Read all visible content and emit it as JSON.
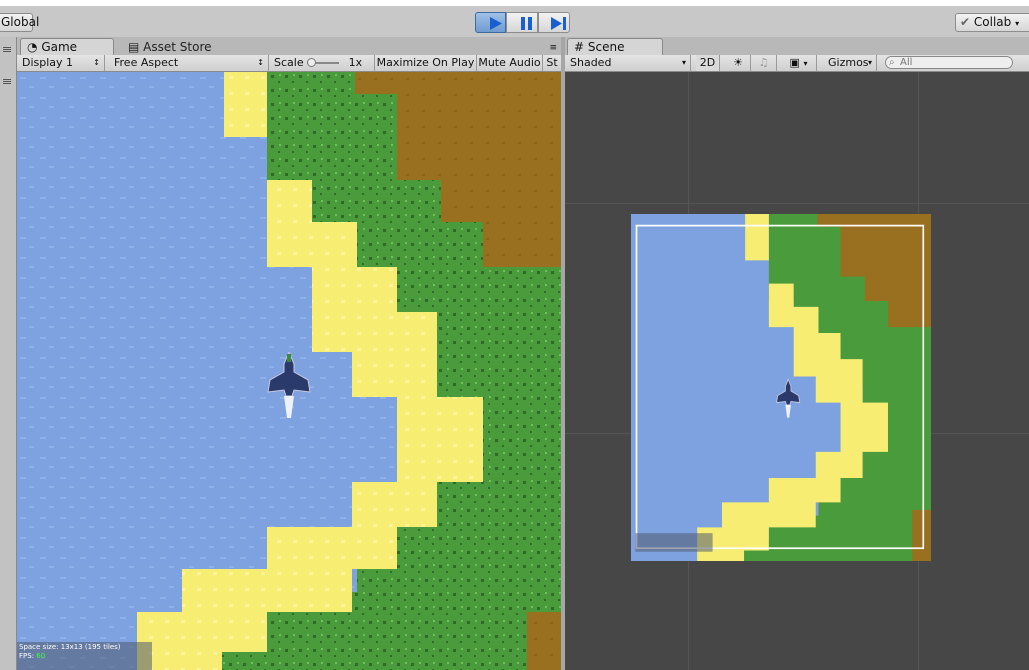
{
  "toolbar": {
    "global_label": "Global",
    "collab_label": "Collab",
    "play_icon": "play-icon",
    "pause_icon": "pause-icon",
    "step_icon": "step-icon",
    "accent": "#3f6aa0"
  },
  "game_panel": {
    "tab_game": "Game",
    "tab_asset_store": "Asset Store",
    "display": "Display 1",
    "aspect": "Free Aspect",
    "scale_label": "Scale",
    "scale_value": "1x",
    "maximize": "Maximize On Play",
    "mute": "Mute Audio",
    "stats_truncated": "St",
    "stats_overlay": {
      "space_size": "Space size: 13x13 (195 tiles)",
      "fps_label": "FPS:",
      "fps_value": "60"
    }
  },
  "scene_panel": {
    "tab_scene": "Scene",
    "shading": "Shaded",
    "mode_2d": "2D",
    "gizmos": "Gizmos",
    "search_placeholder": "All"
  },
  "colors": {
    "water": "#7ea2e0",
    "sand": "#f6ed72",
    "grass": "#4a9b3c",
    "dirt": "#98701f"
  }
}
